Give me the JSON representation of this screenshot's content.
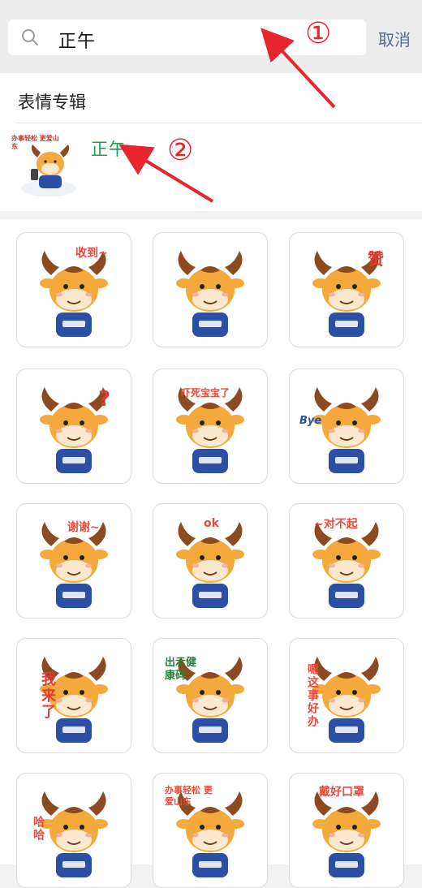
{
  "search": {
    "query": "正午",
    "cancel_label": "取消"
  },
  "album_section": {
    "header": "表情专辑",
    "item_title": "正午",
    "item_thumb_caption": "办事轻松 更爱山东"
  },
  "annotations": {
    "step1": "①",
    "step2": "②"
  },
  "stickers": [
    {
      "name": "received",
      "caption": "收到~"
    },
    {
      "name": "wave",
      "caption": ""
    },
    {
      "name": "thumbs-up",
      "caption": "赞"
    },
    {
      "name": "question",
      "caption": "?"
    },
    {
      "name": "scared",
      "caption": "吓死宝宝了"
    },
    {
      "name": "bye",
      "caption": "Bye"
    },
    {
      "name": "thanks",
      "caption": "谢谢~"
    },
    {
      "name": "ok",
      "caption": "ok"
    },
    {
      "name": "sorry",
      "caption": "~对不起"
    },
    {
      "name": "coming",
      "caption": "我来了"
    },
    {
      "name": "health-code",
      "caption": "出示健康码"
    },
    {
      "name": "easy-task",
      "caption": "嗯这事好办"
    },
    {
      "name": "laugh",
      "caption": "哈哈"
    },
    {
      "name": "easy-love",
      "caption": "办事轻松 更爱山东"
    },
    {
      "name": "mask",
      "caption": "戴好口罩"
    }
  ],
  "badge_text": "i♥山东",
  "colors": {
    "accent_green": "#0fa352",
    "link_blue": "#576b95",
    "annotation_red": "#e8242c",
    "cow_orange": "#f3a93b",
    "shirt_blue": "#2c4fa6"
  }
}
